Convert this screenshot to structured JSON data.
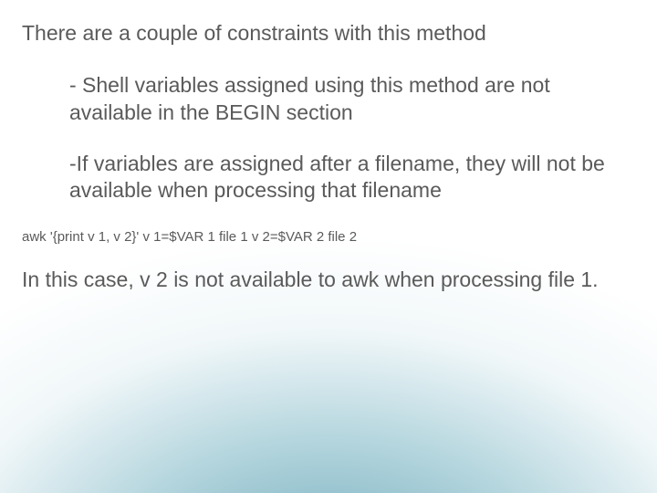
{
  "intro": "There are a couple of constraints with this method",
  "point1": "- Shell variables assigned using this method are not available in the BEGIN section",
  "point2": "-If variables are assigned after a filename, they will not be available when processing that filename",
  "code": "awk '{print v 1, v 2}' v 1=$VAR 1 file 1 v 2=$VAR 2 file 2",
  "conclusion": "In this case, v 2 is not available to awk when processing file 1."
}
